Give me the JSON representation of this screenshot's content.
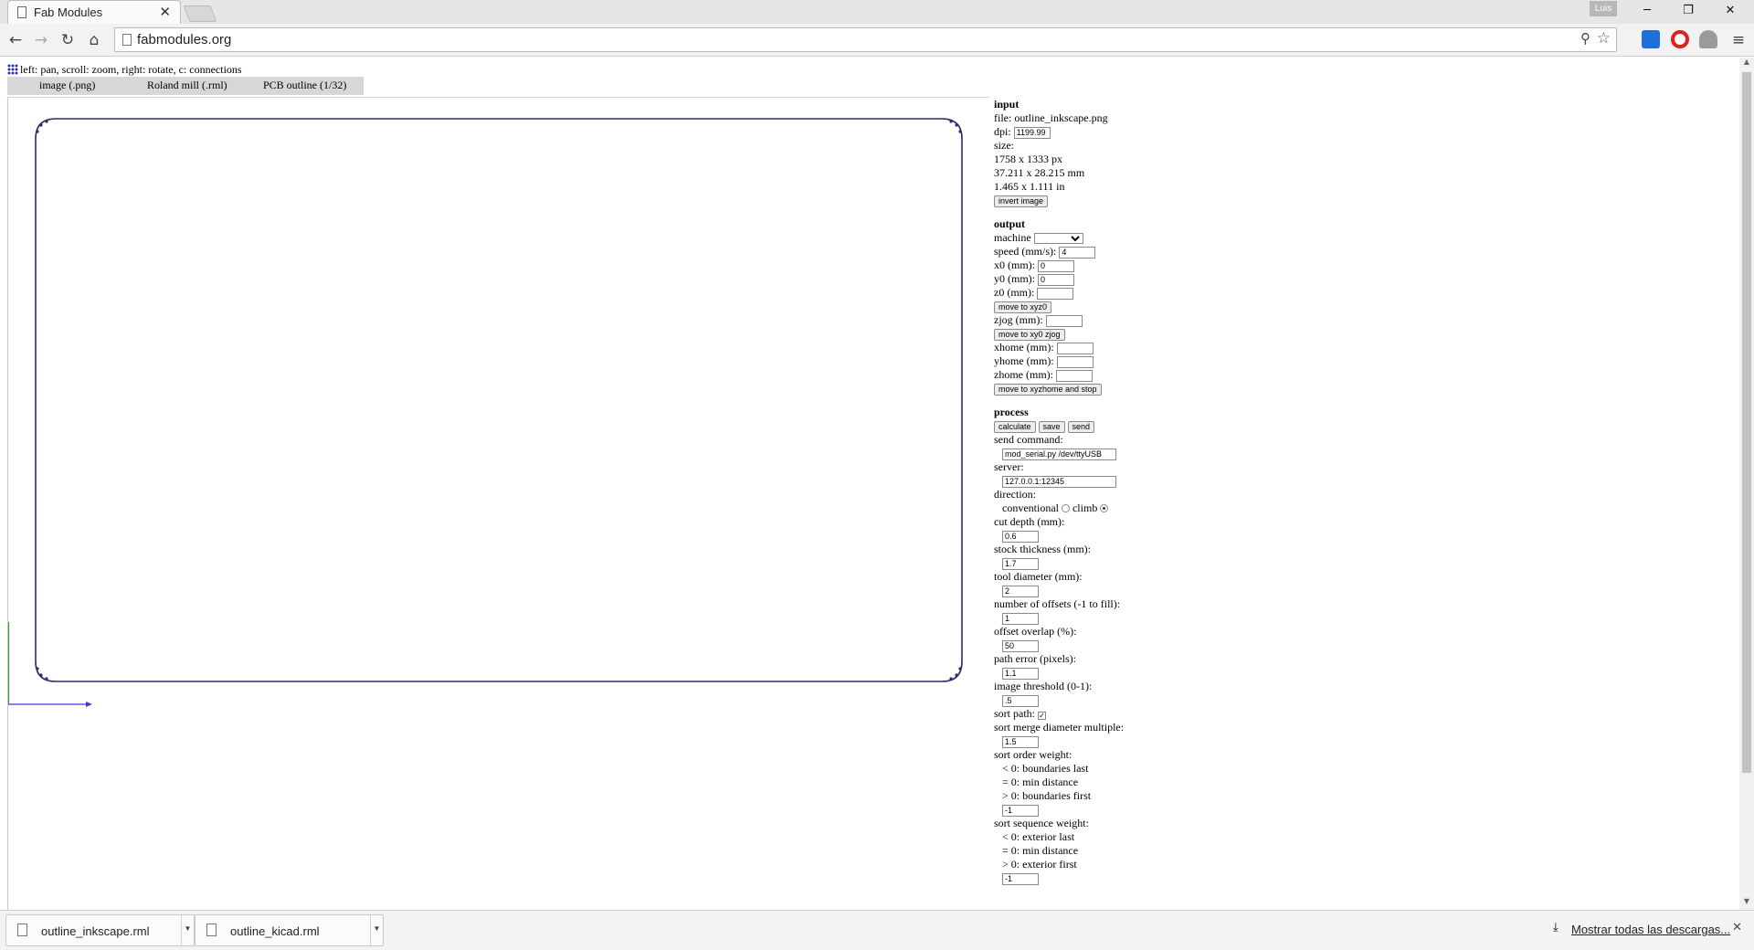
{
  "browser": {
    "tab_title": "Fab Modules",
    "profile_name": "Luis",
    "url": "fabmodules.org"
  },
  "page": {
    "hint": "left: pan, scroll: zoom, right: rotate, c: connections",
    "module_tabs": [
      "image (.png)",
      "Roland mill (.rml)",
      "PCB outline (1/32)"
    ]
  },
  "input": {
    "heading": "input",
    "file_label": "file: outline_inkscape.png",
    "dpi_label": "dpi:",
    "dpi_value": "1199.99",
    "size_label": "size:",
    "size_px": "1758 x 1333 px",
    "size_mm": "37.211 x 28.215 mm",
    "size_in": "1.465 x 1.111 in",
    "invert_button": "invert image"
  },
  "output": {
    "heading": "output",
    "machine_label": "machine",
    "machine_value": "",
    "speed_label": "speed (mm/s):",
    "speed_value": "4",
    "x0_label": "x0 (mm):",
    "x0_value": "0",
    "y0_label": "y0 (mm):",
    "y0_value": "0",
    "z0_label": "z0 (mm):",
    "z0_value": "",
    "move_xyz0_button": "move to xyz0",
    "zjog_label": "zjog (mm):",
    "zjog_value": "",
    "move_xy0zjog_button": "move to xy0 zjog",
    "xhome_label": "xhome (mm):",
    "yhome_label": "yhome (mm):",
    "zhome_label": "zhome (mm):",
    "move_home_button": "move to xyzhome and stop"
  },
  "process": {
    "heading": "process",
    "calculate_button": "calculate",
    "save_button": "save",
    "send_button": "send",
    "send_command_label": "send command:",
    "send_command_value": "mod_serial.py /dev/ttyUSB",
    "server_label": "server:",
    "server_value": "127.0.0.1:12345",
    "direction_label": "direction:",
    "conventional_label": "conventional",
    "climb_label": "climb",
    "cut_depth_label": "cut depth (mm):",
    "cut_depth_value": "0.6",
    "stock_thickness_label": "stock thickness (mm):",
    "stock_thickness_value": "1.7",
    "tool_diameter_label": "tool diameter (mm):",
    "tool_diameter_value": "2",
    "offsets_label": "number of offsets (-1 to fill):",
    "offsets_value": "1",
    "overlap_label": "offset overlap (%):",
    "overlap_value": "50",
    "path_error_label": "path error (pixels):",
    "path_error_value": "1.1",
    "threshold_label": "image threshold (0-1):",
    "threshold_value": ".5",
    "sort_path_label": "sort path:",
    "merge_label": "sort merge diameter multiple:",
    "merge_value": "1.5",
    "order_weight_label": "sort order weight:",
    "order_lt": "< 0: boundaries last",
    "order_eq": "= 0: min distance",
    "order_gt": "> 0: boundaries first",
    "order_value": "-1",
    "seq_weight_label": "sort sequence weight:",
    "seq_lt": "< 0: exterior last",
    "seq_eq": "= 0: min distance",
    "seq_gt": "> 0: exterior first",
    "seq_value": "-1"
  },
  "downloads": {
    "items": [
      "outline_inkscape.rml",
      "outline_kicad.rml"
    ],
    "show_all": "Mostrar todas las descargas..."
  },
  "colors": {
    "path": "#2b2b6e",
    "axis_x": "#3b3bd0",
    "axis_y": "#2aa02a"
  }
}
